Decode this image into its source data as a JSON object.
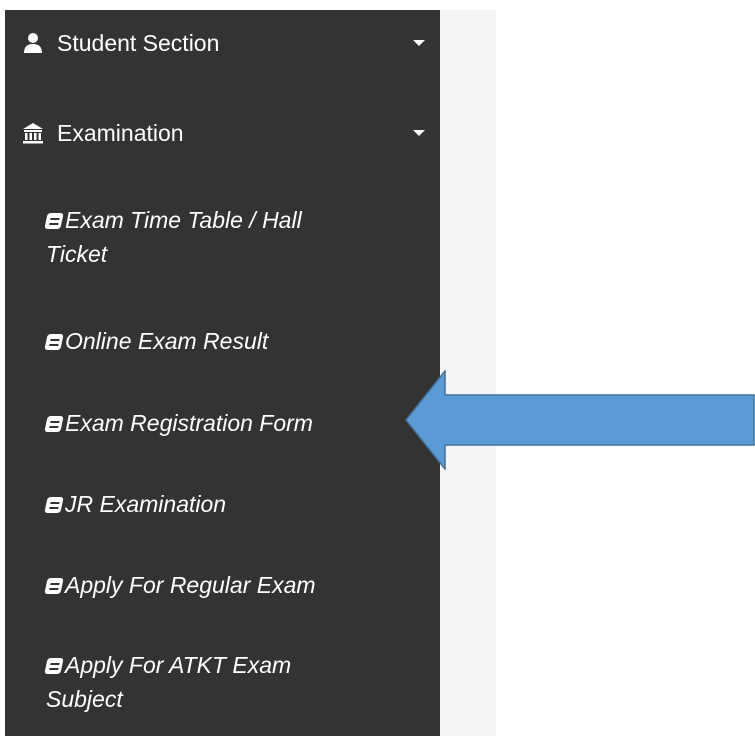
{
  "sidebar": {
    "sections": [
      {
        "label": "Student Section",
        "icon": "user-icon"
      },
      {
        "label": "Examination",
        "icon": "institution-icon"
      }
    ],
    "items": [
      {
        "label_line1": "Exam Time Table / Hall",
        "label_line2": "Ticket"
      },
      {
        "label_line1": "Online Exam Result"
      },
      {
        "label_line1": "Exam Registration Form"
      },
      {
        "label_line1": "JR Examination"
      },
      {
        "label_line1": "Apply For Regular Exam"
      },
      {
        "label_line1": "Apply For ATKT Exam",
        "label_line2": "Subject"
      }
    ]
  },
  "colors": {
    "sidebar_bg": "#333333",
    "arrow_fill": "#5b9bd5",
    "arrow_stroke": "#41719c"
  }
}
